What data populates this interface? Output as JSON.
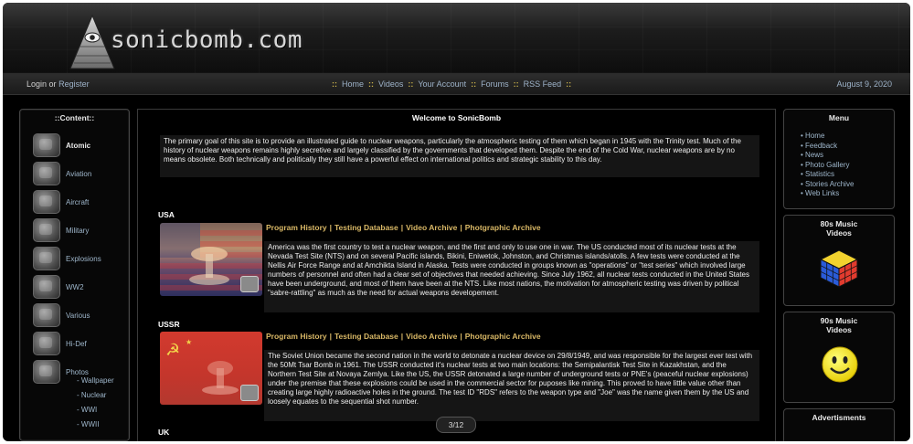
{
  "header": {
    "site_name": "sonicbomb.com"
  },
  "nav": {
    "login": "Login",
    "or": "or",
    "register": "Register",
    "links": [
      "Home",
      "Videos",
      "Your Account",
      "Forums",
      "RSS Feed"
    ],
    "separator": "::",
    "date": "August 9, 2020"
  },
  "content_panel": {
    "title": "::Content::",
    "items": [
      {
        "label": "Atomic",
        "icon": "atomic-icon",
        "active": true
      },
      {
        "label": "Aviation",
        "icon": "aviation-icon"
      },
      {
        "label": "Aircraft",
        "icon": "aircraft-icon"
      },
      {
        "label": "Military",
        "icon": "military-icon"
      },
      {
        "label": "Explosions",
        "icon": "explosions-icon"
      },
      {
        "label": "WW2",
        "icon": "ww2-icon"
      },
      {
        "label": "Various",
        "icon": "various-icon"
      },
      {
        "label": "Hi-Def",
        "icon": "hd-icon"
      },
      {
        "label": "Photos",
        "icon": "camera-icon"
      }
    ],
    "photo_subitems": [
      "Wallpaper",
      "Nuclear",
      "WWI",
      "WWII"
    ]
  },
  "main": {
    "title": "Welcome to SonicBomb",
    "intro": "The primary goal of this site is to provide an illustrated guide to nuclear weapons, particularly the atmospheric testing of them which began in 1945 with the Trinity test. Much of the history of nuclear weapons remains highly secretive and largely classified by the governments that developed them. Despite the end of the Cold War, nuclear weapons are by no means obsolete. Both technically and politically they still have a powerful effect on international politics and strategic stability to this day.",
    "sections": [
      {
        "country": "USA",
        "links": [
          "Program History",
          "Testing Database",
          "Video Archive",
          "Photgraphic Archive"
        ],
        "text": "America was the first country to test a nuclear weapon, and the first and only to use one in war. The US conducted most of its nuclear tests at the Nevada Test Site (NTS) and on several Pacific islands, Bikini, Eniwetok, Johnston, and Christmas islands/atolls. A few tests were conducted at the Nellis Air Force Range and at Amchikta Island in Alaska. Tests were conducted in groups known as \"operations\" or \"test series\" which involved large numbers of personnel and often had a clear set of objectives that needed achieving. Since July 1962, all nuclear tests conducted in the United States have been underground, and most of them have been at the NTS. Like most nations, the motivation for atmospheric testing was driven by political \"sabre-rattling\" as much as the need for actual weapons developement."
      },
      {
        "country": "USSR",
        "links": [
          "Program History",
          "Testing Database",
          "Video Archive",
          "Photgraphic Archive"
        ],
        "text": "The Soviet Union became the second nation in the world to detonate a nuclear device on 29/8/1949, and was responsible for the largest ever test with the 50Mt Tsar Bomb in 1961. The USSR conducted it's nuclear tests at two main locations: the Semipalantisk Test Site in Kazakhstan, and the Northern Test Site at Novaya Zemlya. Like the US, the USSR detonated a large number of underground tests or PNE's (peaceful nuclear explosions) under the premise that these explosions could be used in the commercial sector for puposes like mining. This proved to have little value other than creating large highly radioactive holes in the ground. The test ID \"RDS\" refers to the weapon type and \"Joe\" was the name given them by the US and loosely equates to the sequential shot number."
      },
      {
        "country": "UK"
      }
    ],
    "link_separator": "|"
  },
  "right": {
    "menu_title": "Menu",
    "menu_items": [
      "Home",
      "Feedback",
      "News",
      "Photo Gallery",
      "Statistics",
      "Stories Archive",
      "Web Links"
    ],
    "menu_bullet": "•",
    "music80_title": "80s Music Videos",
    "music90_title": "90s Music Videos",
    "ads_title": "Advertisments"
  },
  "pager": "3/12"
}
